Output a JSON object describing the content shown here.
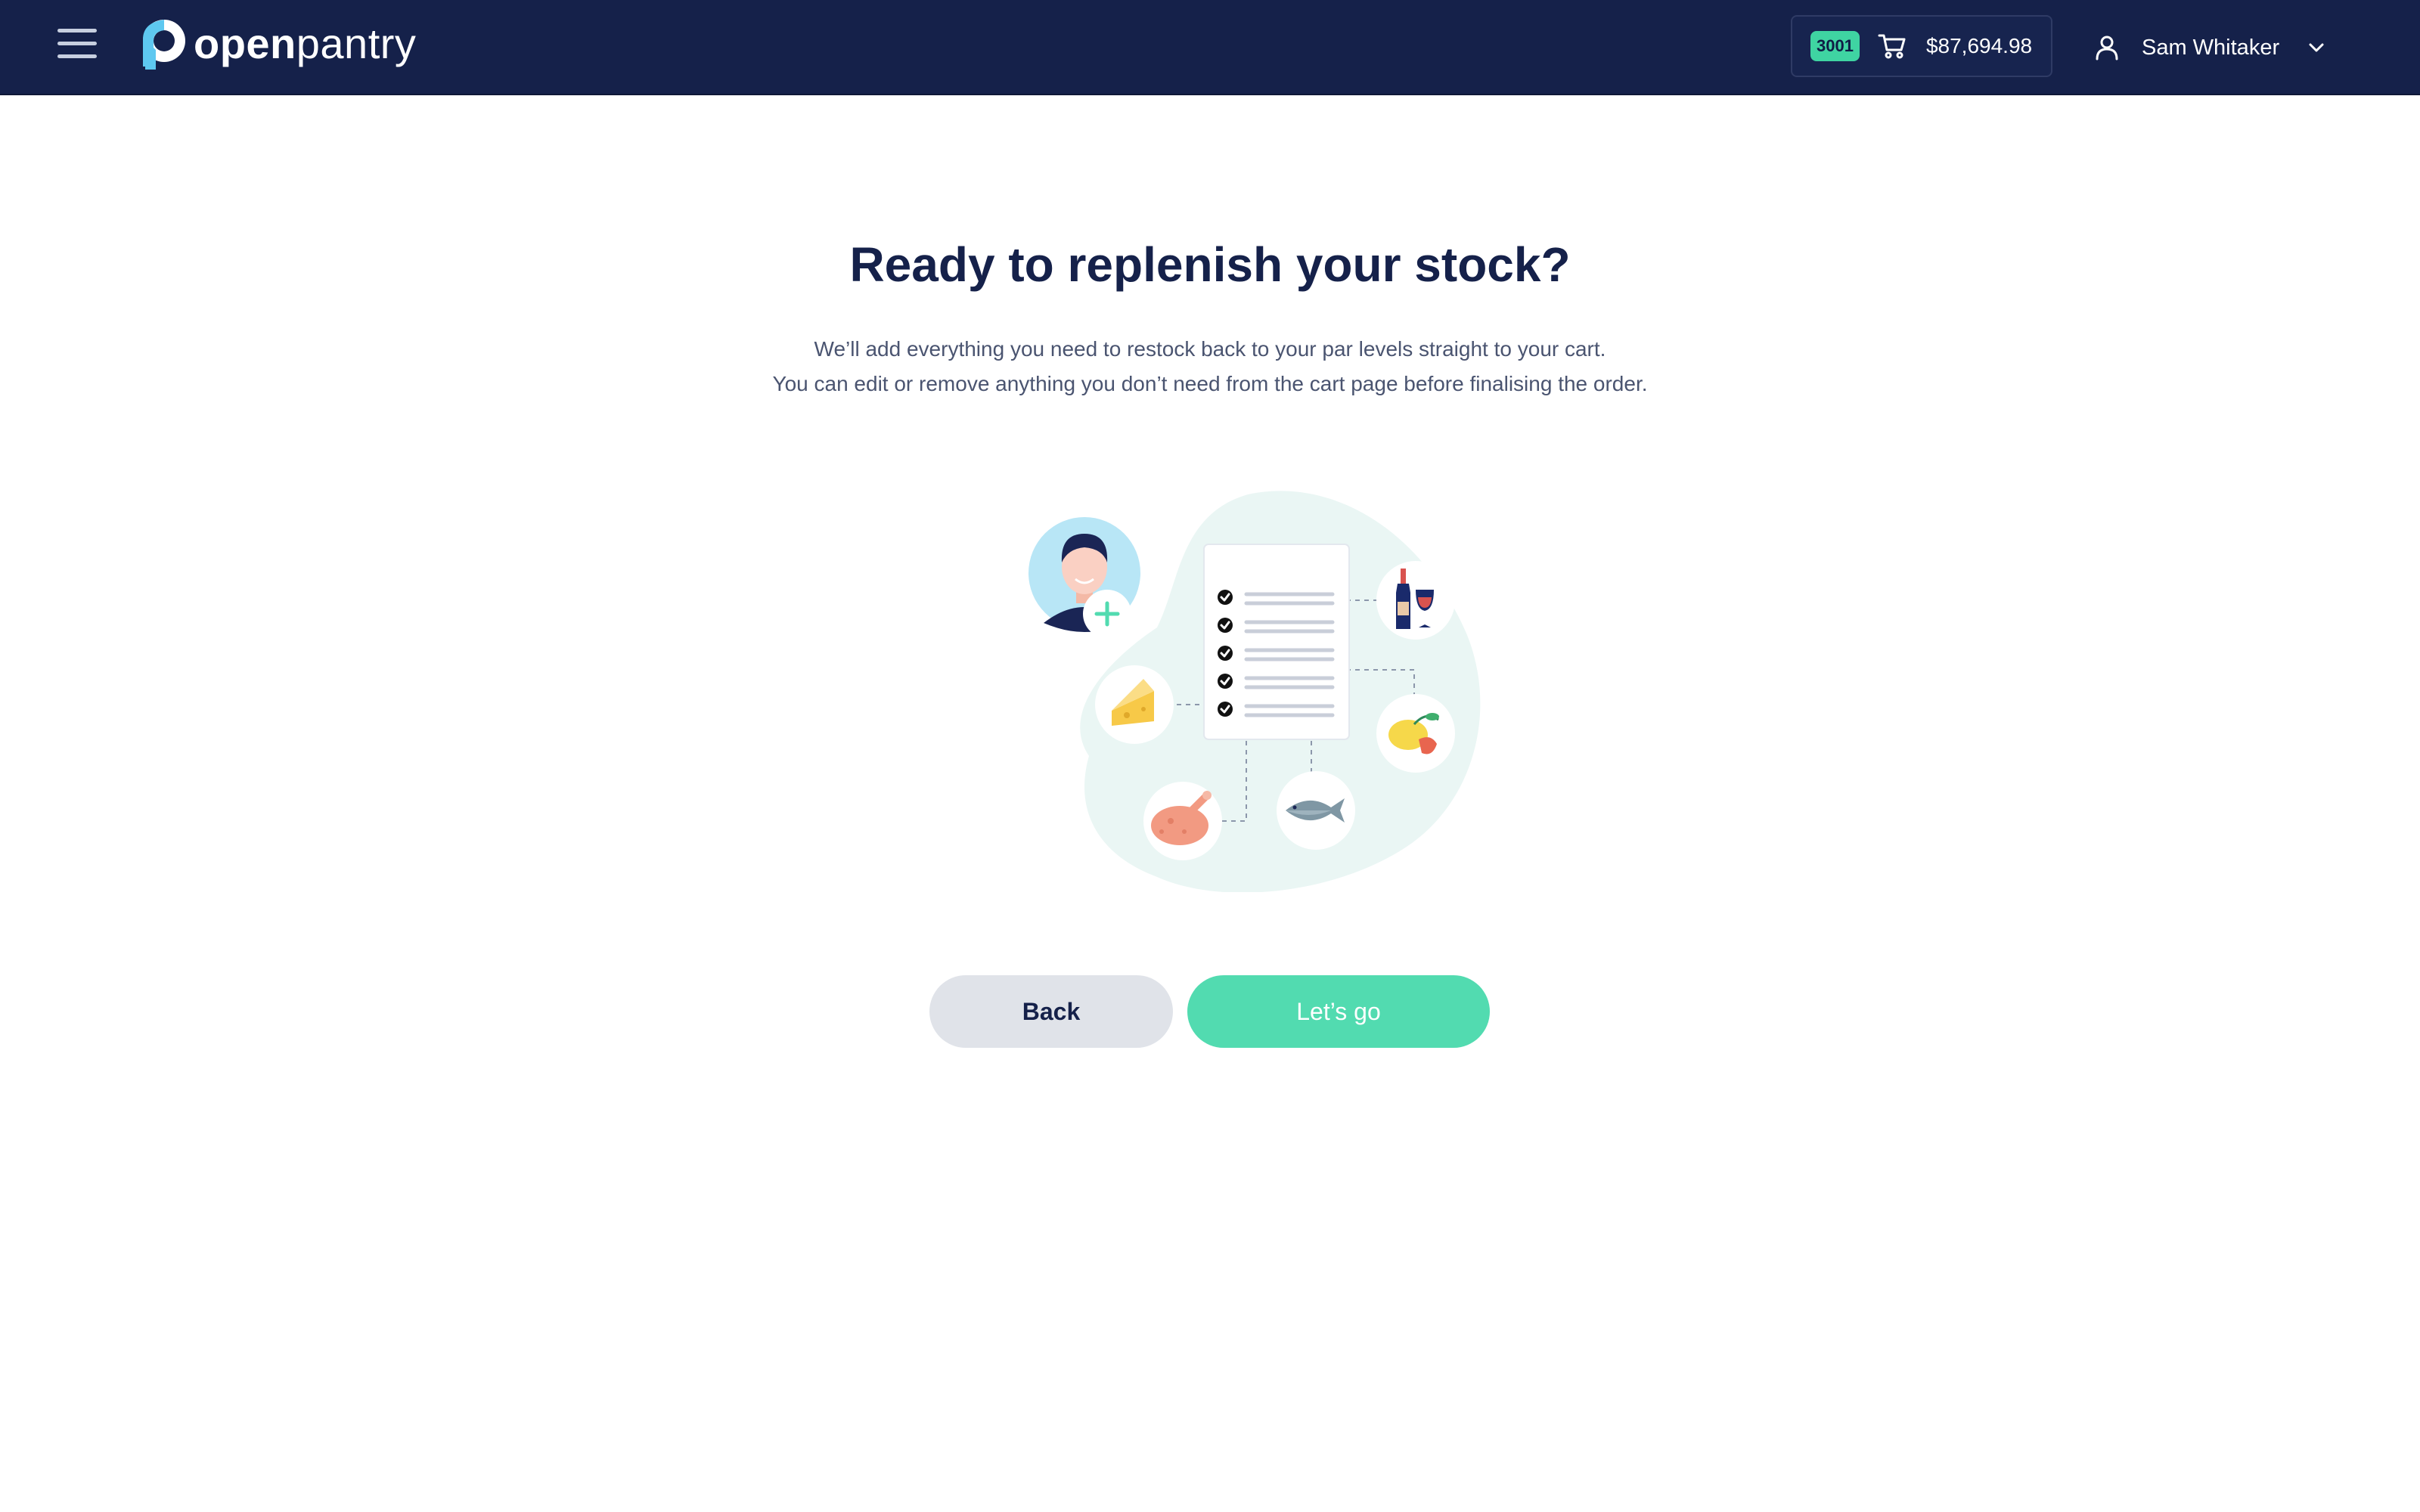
{
  "header": {
    "menu_icon": "hamburger-menu-icon",
    "logo": {
      "bold": "open",
      "light": "pantry"
    },
    "cart": {
      "badge": "3001",
      "icon": "shopping-cart-icon",
      "total": "$87,694.98"
    },
    "user": {
      "icon": "user-icon",
      "name": "Sam Whitaker",
      "dropdown_icon": "chevron-down-icon"
    }
  },
  "main": {
    "title": "Ready to replenish your stock?",
    "subtitle_line1": "We’ll add everything you need to restock back to your par levels straight to your cart.",
    "subtitle_line2": "You can edit or remove anything you don’t need from the cart page before finalising the order.",
    "illustration": {
      "items": [
        "person-avatar",
        "checklist",
        "wine",
        "cheese",
        "citrus-fruit",
        "roast-chicken",
        "fish"
      ]
    }
  },
  "actions": {
    "back_label": "Back",
    "go_label": "Let’s go"
  },
  "colors": {
    "header_bg": "#15214a",
    "accent": "#52dbb0",
    "title": "#15214a",
    "body_text": "#4a5470",
    "secondary_button": "#e0e3e9"
  }
}
